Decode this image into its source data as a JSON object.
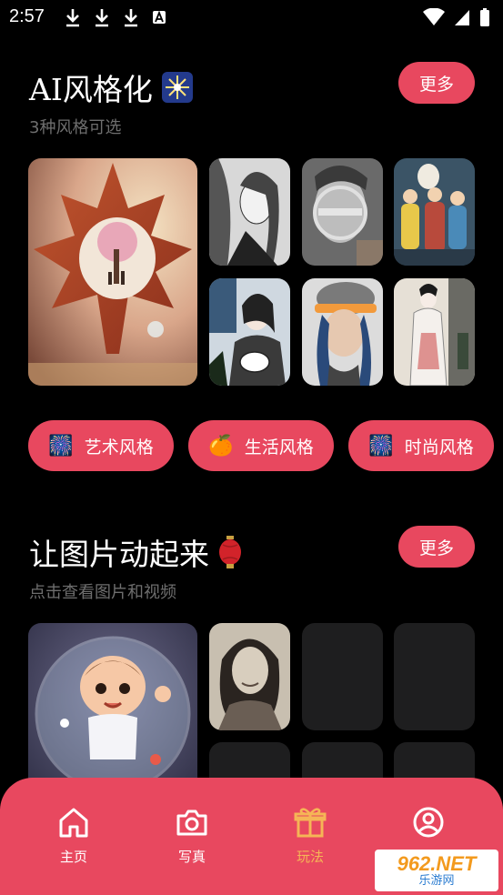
{
  "status_bar": {
    "time": "2:57"
  },
  "section1": {
    "title": "AI风格化",
    "title_emoji": "🎆",
    "subtitle": "3种风格可选",
    "more_label": "更多"
  },
  "chips": [
    {
      "emoji": "🎆",
      "label": "艺术风格"
    },
    {
      "emoji": "🍊",
      "label": "生活风格"
    },
    {
      "emoji": "🎆",
      "label": "时尚风格"
    }
  ],
  "section2": {
    "title": "让图片动起来",
    "title_emoji": "🏮",
    "subtitle": "点击查看图片和视频",
    "more_label": "更多"
  },
  "nav": [
    {
      "label": "主页"
    },
    {
      "label": "写真"
    },
    {
      "label": "玩法"
    },
    {
      "label": ""
    }
  ],
  "watermark": {
    "top": "962.NET",
    "bottom": "乐游网"
  },
  "colors": {
    "accent": "#e8485f",
    "active_nav": "#f5b556",
    "background": "#000000"
  }
}
